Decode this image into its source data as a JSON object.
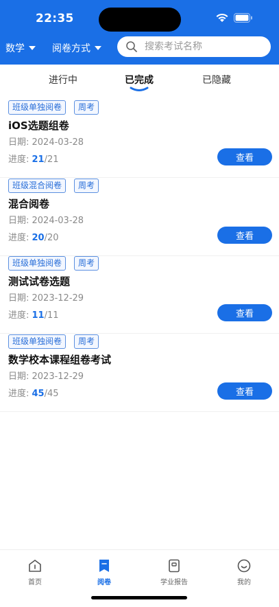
{
  "status_bar": {
    "time": "22:35"
  },
  "header": {
    "subject_filter": "数学",
    "mode_filter": "阅卷方式",
    "search_placeholder": "搜索考试名称"
  },
  "tabs": [
    {
      "label": "进行中",
      "active": false
    },
    {
      "label": "已完成",
      "active": true
    },
    {
      "label": "已隐藏",
      "active": false
    }
  ],
  "exams": [
    {
      "tags": [
        "班级单独阅卷",
        "周考"
      ],
      "title": "iOS选题组卷",
      "date": "日期: 2024-03-28",
      "progress_label": "进度: ",
      "done": "21",
      "total": "/21",
      "button": "查看"
    },
    {
      "tags": [
        "班级混合阅卷",
        "周考"
      ],
      "title": "混合阅卷",
      "date": "日期: 2024-03-28",
      "progress_label": "进度: ",
      "done": "20",
      "total": "/20",
      "button": "查看"
    },
    {
      "tags": [
        "班级单独阅卷",
        "周考"
      ],
      "title": "测试试卷选题",
      "date": "日期: 2023-12-29",
      "progress_label": "进度: ",
      "done": "11",
      "total": "/11",
      "button": "查看"
    },
    {
      "tags": [
        "班级单独阅卷",
        "周考"
      ],
      "title": "数学校本课程组卷考试",
      "date": "日期: 2023-12-29",
      "progress_label": "进度: ",
      "done": "45",
      "total": "/45",
      "button": "查看"
    }
  ],
  "bottom_nav": [
    {
      "label": "首页",
      "icon": "home-icon",
      "active": false
    },
    {
      "label": "阅卷",
      "icon": "grading-icon",
      "active": true
    },
    {
      "label": "学业报告",
      "icon": "report-icon",
      "active": false
    },
    {
      "label": "我的",
      "icon": "profile-icon",
      "active": false
    }
  ],
  "colors": {
    "primary": "#1a6fe6",
    "tag_border": "#5a8fe0",
    "muted_text": "#8a8a8a"
  }
}
